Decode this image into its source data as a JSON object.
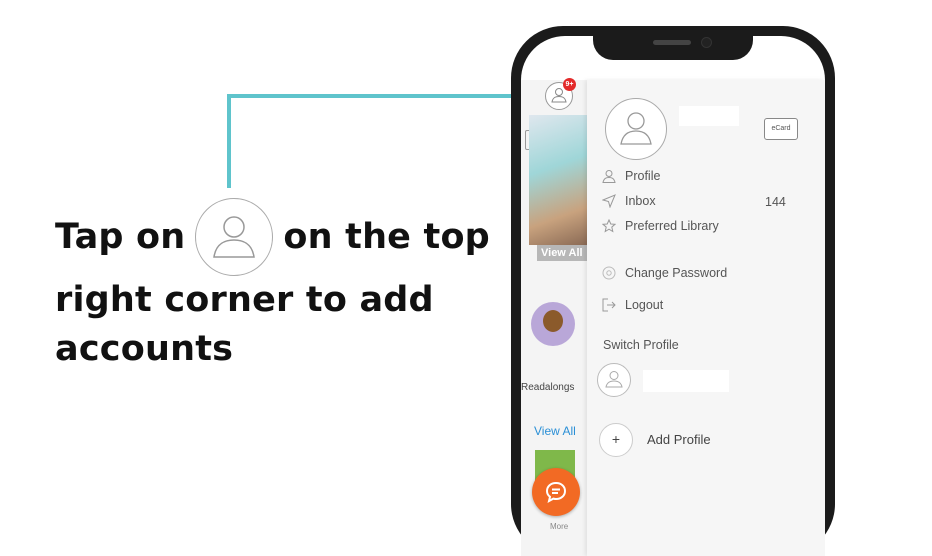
{
  "instruction": {
    "line1_before": "Tap on",
    "line1_after": "on the top",
    "line2": "right corner to add",
    "line3": "accounts"
  },
  "colors": {
    "connector": "#5fc4cc",
    "fab": "#f26a24",
    "badge": "#e32a2a",
    "link": "#2a8fd6"
  },
  "app_strip": {
    "notification_badge": "9+",
    "view_all_overlay": "View All",
    "section_label": "Readalongs",
    "view_all_link": "View All",
    "fab_icon": "chat-icon",
    "more_label": "More"
  },
  "drawer": {
    "ecard_label": "eCard",
    "menu": [
      {
        "label": "Profile",
        "icon": "person-icon"
      },
      {
        "label": "Inbox",
        "icon": "send-icon",
        "count": "144"
      },
      {
        "label": "Preferred Library",
        "icon": "star-icon"
      },
      {
        "label": "Change Password",
        "icon": "at-icon"
      },
      {
        "label": "Logout",
        "icon": "logout-icon"
      }
    ],
    "switch_profile_label": "Switch Profile",
    "add_profile_icon": "+",
    "add_profile_label": "Add Profile"
  }
}
